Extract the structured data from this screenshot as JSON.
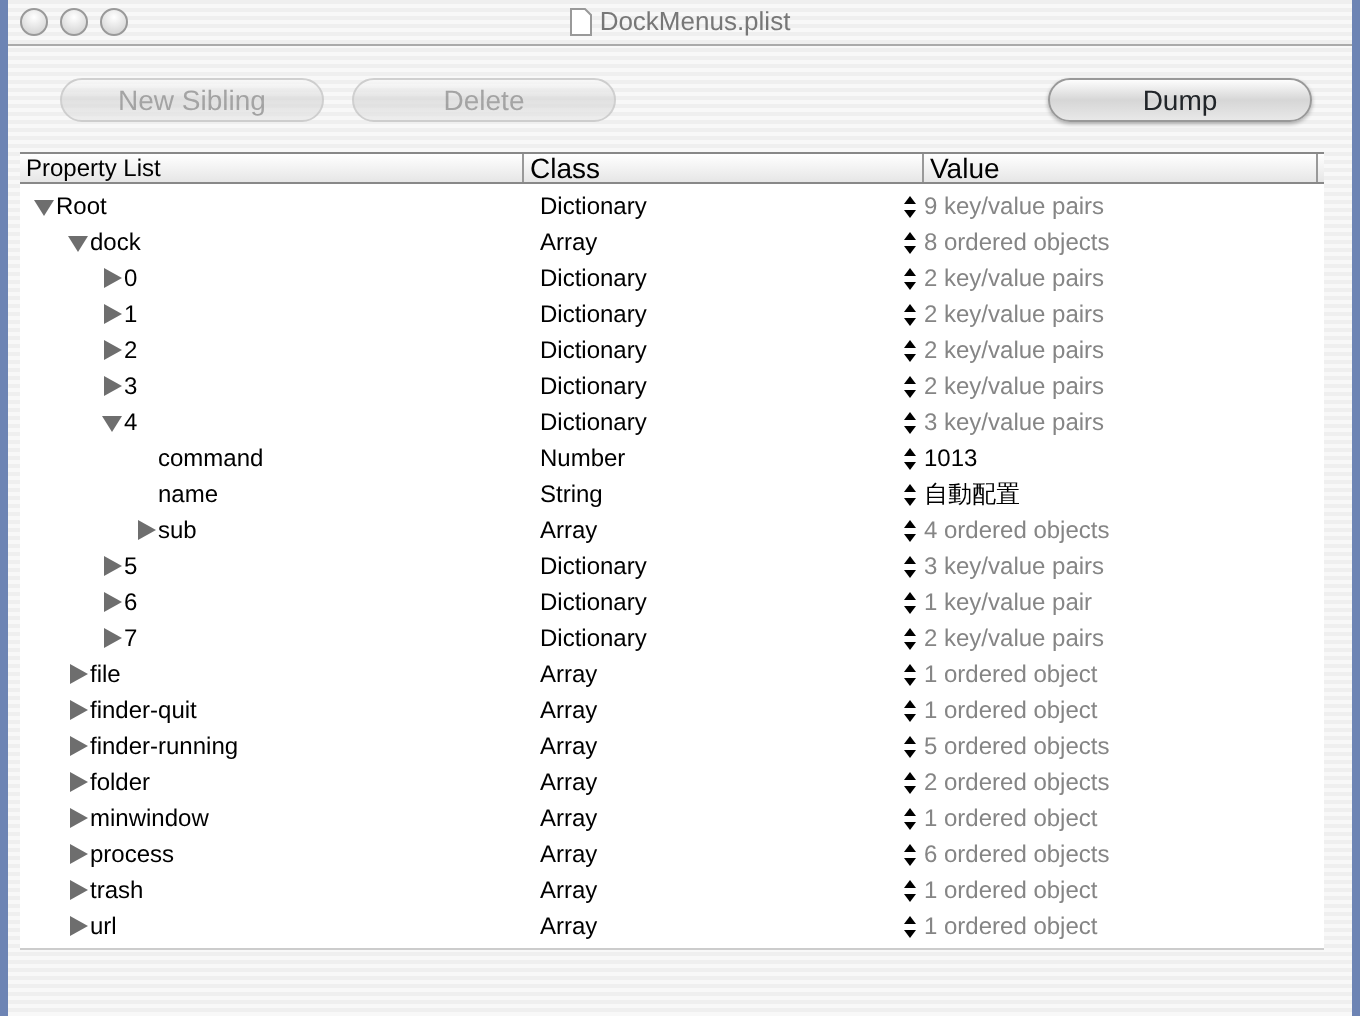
{
  "window": {
    "title": "DockMenus.plist"
  },
  "toolbar": [
    {
      "label": "New Sibling",
      "disabled": true
    },
    {
      "label": "Delete",
      "disabled": true
    },
    {
      "label": "Dump",
      "disabled": false
    }
  ],
  "columns": [
    "Property List",
    "Class",
    "Value"
  ],
  "tree": [
    {
      "key": "Root",
      "class": "Dictionary",
      "value": "9 key/value pairs",
      "kind": "summary",
      "expanded": true,
      "children": [
        {
          "key": "dock",
          "class": "Array",
          "value": "8 ordered objects",
          "kind": "summary",
          "expanded": true,
          "children": [
            {
              "key": "0",
              "class": "Dictionary",
              "value": "2 key/value pairs",
              "kind": "summary",
              "expanded": false
            },
            {
              "key": "1",
              "class": "Dictionary",
              "value": "2 key/value pairs",
              "kind": "summary",
              "expanded": false
            },
            {
              "key": "2",
              "class": "Dictionary",
              "value": "2 key/value pairs",
              "kind": "summary",
              "expanded": false
            },
            {
              "key": "3",
              "class": "Dictionary",
              "value": "2 key/value pairs",
              "kind": "summary",
              "expanded": false
            },
            {
              "key": "4",
              "class": "Dictionary",
              "value": "3 key/value pairs",
              "kind": "summary",
              "expanded": true,
              "children": [
                {
                  "key": "command",
                  "class": "Number",
                  "value": "1013",
                  "kind": "scalar"
                },
                {
                  "key": "name",
                  "class": "String",
                  "value": "自動配置",
                  "kind": "scalar"
                },
                {
                  "key": "sub",
                  "class": "Array",
                  "value": "4 ordered objects",
                  "kind": "summary",
                  "expanded": false
                }
              ]
            },
            {
              "key": "5",
              "class": "Dictionary",
              "value": "3 key/value pairs",
              "kind": "summary",
              "expanded": false
            },
            {
              "key": "6",
              "class": "Dictionary",
              "value": "1 key/value pair",
              "kind": "summary",
              "expanded": false
            },
            {
              "key": "7",
              "class": "Dictionary",
              "value": "2 key/value pairs",
              "kind": "summary",
              "expanded": false
            }
          ]
        },
        {
          "key": "file",
          "class": "Array",
          "value": "1 ordered object",
          "kind": "summary",
          "expanded": false
        },
        {
          "key": "finder-quit",
          "class": "Array",
          "value": "1 ordered object",
          "kind": "summary",
          "expanded": false
        },
        {
          "key": "finder-running",
          "class": "Array",
          "value": "5 ordered objects",
          "kind": "summary",
          "expanded": false
        },
        {
          "key": "folder",
          "class": "Array",
          "value": "2 ordered objects",
          "kind": "summary",
          "expanded": false
        },
        {
          "key": "minwindow",
          "class": "Array",
          "value": "1 ordered object",
          "kind": "summary",
          "expanded": false
        },
        {
          "key": "process",
          "class": "Array",
          "value": "6 ordered objects",
          "kind": "summary",
          "expanded": false
        },
        {
          "key": "trash",
          "class": "Array",
          "value": "1 ordered object",
          "kind": "summary",
          "expanded": false
        },
        {
          "key": "url",
          "class": "Array",
          "value": "1 ordered object",
          "kind": "summary",
          "expanded": false
        }
      ]
    }
  ]
}
